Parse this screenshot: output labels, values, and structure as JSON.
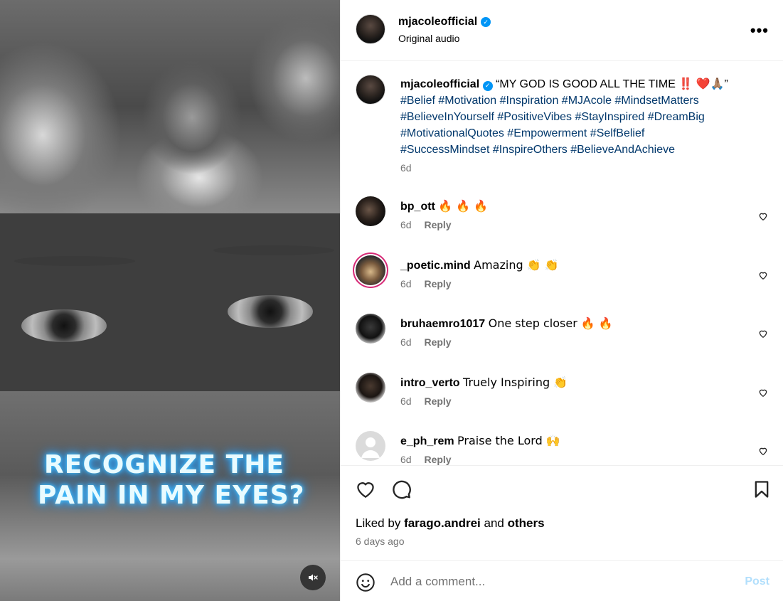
{
  "media": {
    "caption_line1": "RECOGNIZE THE",
    "caption_line2": "PAIN IN MY EYES?",
    "mute_icon": "speaker-muted-icon"
  },
  "header": {
    "username": "mjacoleofficial",
    "verified": true,
    "subtitle": "Original audio",
    "more_icon": "more-horizontal-icon",
    "more_label": "•••"
  },
  "post_caption": {
    "username": "mjacoleofficial",
    "text": "“MY GOD IS GOOD ALL THE TIME ‼️ ❤️🙏🏽”",
    "hashtags_line1": "#Belief #Motivation #Inspiration #MJAcole #MindsetMatters",
    "hashtags_line2": "#BelieveInYourself #PositiveVibes #StayInspired #DreamBig",
    "hashtags_line3": "#MotivationalQuotes #Empowerment #SelfBelief",
    "hashtags_line4": "#SuccessMindset #InspireOthers #BelieveAndAchieve",
    "time": "6d"
  },
  "comments": [
    {
      "username": "bp_ott",
      "text": "🔥 🔥 🔥",
      "time": "6d",
      "reply": "Reply"
    },
    {
      "username": "_poetic.mind",
      "text": "Amazing 👏 👏",
      "time": "6d",
      "reply": "Reply"
    },
    {
      "username": "bruhaemro1017",
      "text": "One step closer 🔥 🔥",
      "time": "6d",
      "reply": "Reply"
    },
    {
      "username": "intro_verto",
      "text": "Truely Inspiring 👏",
      "time": "6d",
      "reply": "Reply"
    },
    {
      "username": "e_ph_rem",
      "text": "Praise the Lord 🙌",
      "time": "6d",
      "reply": "Reply"
    }
  ],
  "actions": {
    "liked_prefix": "Liked by",
    "liked_user": "farago.andrei",
    "liked_and": "and",
    "liked_others": "others",
    "posted_ago": "6 days ago"
  },
  "comment_box": {
    "placeholder": "Add a comment...",
    "post_label": "Post"
  },
  "colors": {
    "link": "#00376b",
    "verified": "#0095f6",
    "post_disabled": "#b2dffc",
    "muted_text": "#737373"
  }
}
